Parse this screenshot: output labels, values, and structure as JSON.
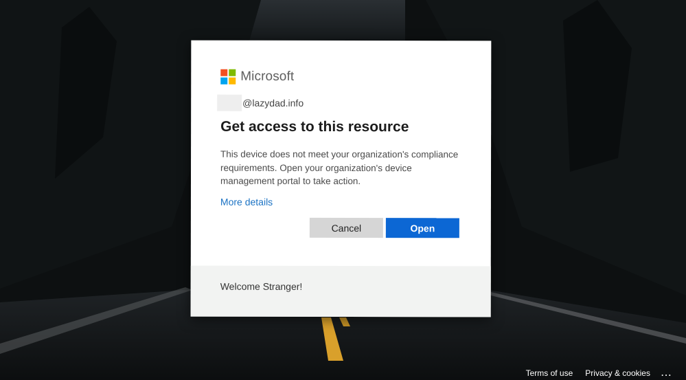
{
  "dialog": {
    "brand": "Microsoft",
    "logo_colors": [
      "#f25022",
      "#7fba00",
      "#00a4ef",
      "#ffb900"
    ],
    "account_domain": "@lazydad.info",
    "title": "Get access to this resource",
    "description": "This device does not meet your organization's compliance requirements. Open your organization's device management portal to take action.",
    "more_details_label": "More details",
    "cancel_label": "Cancel",
    "open_label": "Open",
    "welcome": "Welcome Stranger!"
  },
  "footer": {
    "terms_label": "Terms of use",
    "privacy_label": "Privacy & cookies",
    "more_label": "..."
  }
}
